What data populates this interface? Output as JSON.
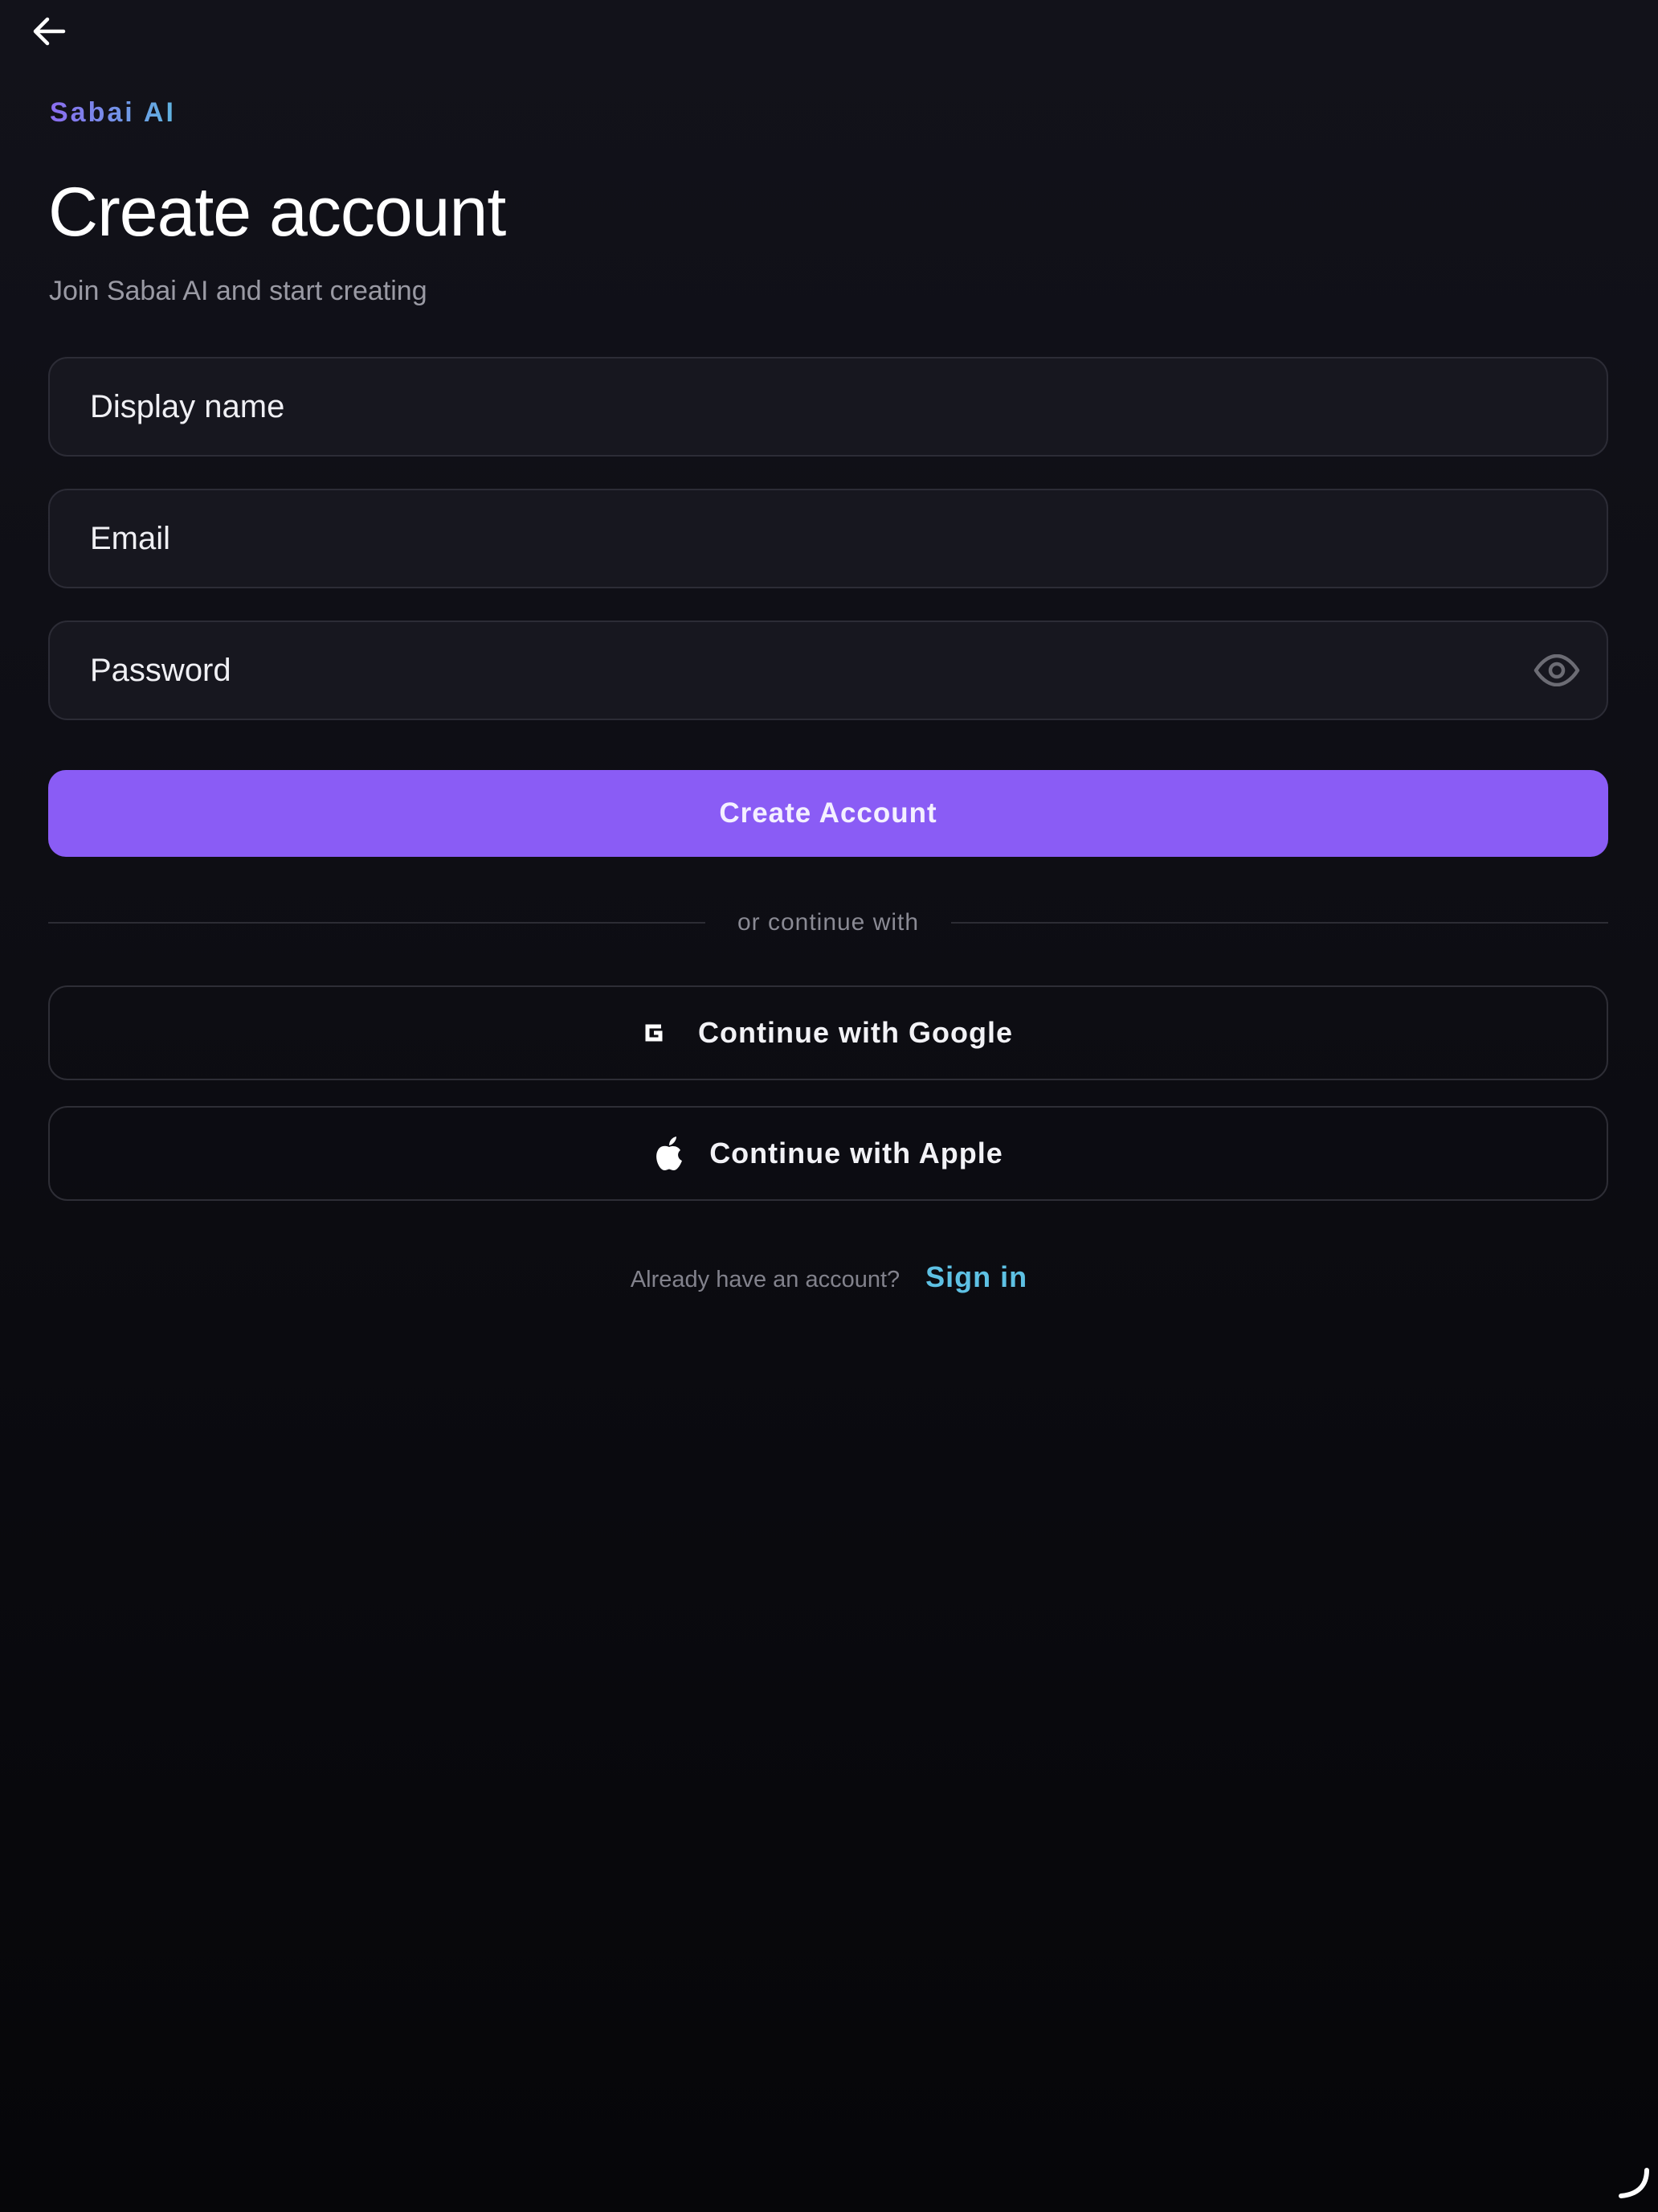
{
  "header": {
    "back_icon": "arrow-left-icon",
    "brand": "Sabai AI"
  },
  "intro": {
    "title": "Create account",
    "subtitle": "Join Sabai AI and start creating"
  },
  "form": {
    "display_name": {
      "placeholder": "Display name",
      "value": ""
    },
    "email": {
      "placeholder": "Email",
      "value": ""
    },
    "password": {
      "placeholder": "Password",
      "value": "",
      "toggle_icon": "eye-icon"
    },
    "submit_label": "Create Account"
  },
  "divider": {
    "text": "or continue with"
  },
  "social": {
    "google": {
      "label": "Continue with Google",
      "icon": "google-icon"
    },
    "apple": {
      "label": "Continue with Apple",
      "icon": "apple-icon"
    }
  },
  "footer": {
    "prompt": "Already have an account?",
    "link": "Sign in"
  },
  "colors": {
    "accent": "#8a5cf5",
    "link": "#5ec1e4",
    "background": "#0d0d13",
    "field_bg": "#17171f",
    "border": "#2c2c36"
  }
}
